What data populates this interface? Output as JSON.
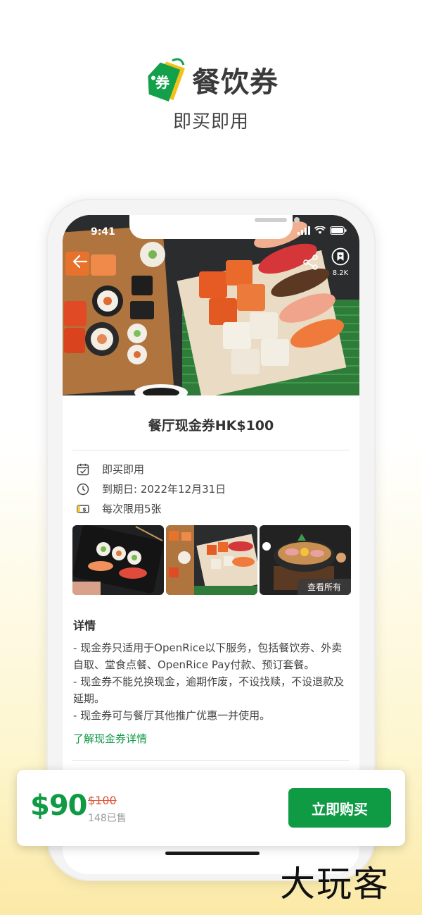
{
  "promo": {
    "icon_text": "券",
    "title": "餐饮券",
    "subtitle": "即买即用"
  },
  "status_bar": {
    "time": "9:41"
  },
  "hero": {
    "bookmark_count": "8.2K"
  },
  "voucher": {
    "title": "餐厅现金券HK$100",
    "info": [
      {
        "icon": "calendar-check-icon",
        "text": "即买即用"
      },
      {
        "icon": "clock-icon",
        "text": "到期日: 2022年12月31日"
      },
      {
        "icon": "cash-icon",
        "text": "每次限用5张"
      }
    ],
    "see_all": "查看所有",
    "details_title": "详情",
    "details": [
      "- 现金券只适用于OpenRice以下服务，包括餐饮券、外卖自取、堂食点餐、OpenRice Pay付款、预订套餐。",
      "- 现金券不能兑换现金，逾期作废，不设找赎，不设退款及延期。",
      "- 现金券可与餐厅其他推广优惠一并使用。"
    ],
    "more_link": "了解现金券详情"
  },
  "buy_bar": {
    "price": "$90",
    "original_price": "$100",
    "sold": "148已售",
    "buy_label": "立即购买"
  },
  "colors": {
    "brand_green": "#0f9a44",
    "original_price_red": "#e0533a"
  },
  "watermark": "大玩客"
}
